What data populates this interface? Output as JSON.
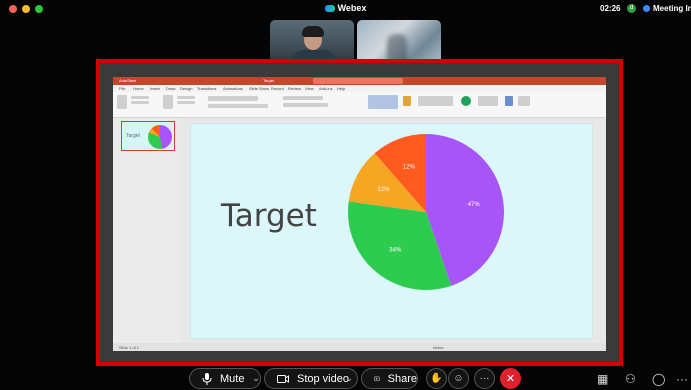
{
  "window": {
    "title": "Webex",
    "clock": "02:26",
    "avatar_initial": "d",
    "meeting_label": "Meeting In"
  },
  "shared_app": {
    "title": "Target",
    "search_placeholder": "Search (Cmd+E)",
    "tabs": [
      "File",
      "Home",
      "Insert",
      "Draw",
      "Design",
      "Transitions",
      "Animations",
      "Slide Show",
      "Record",
      "Review",
      "View",
      "Add-ins",
      "Help"
    ],
    "status_left": "Slide 1 of 1",
    "status_right": "Notes"
  },
  "slide": {
    "title": "Target",
    "thumb_title": "Target",
    "pie_colors": [
      "#a855f7",
      "#2ecc4e",
      "#f5a623",
      "#ff5a1f"
    ],
    "pie_labels": [
      "47%",
      "34%",
      "12%",
      "12%"
    ]
  },
  "chart_data": {
    "type": "pie",
    "values": [
      47,
      34,
      12,
      12
    ],
    "labels": [
      "47%",
      "34%",
      "12%",
      "12%"
    ],
    "colors": [
      "#a855f7",
      "#2ecc4e",
      "#f5a623",
      "#ff5a1f"
    ]
  },
  "controls": {
    "mute_label": "Mute",
    "video_label": "Stop video",
    "share_label": "Share",
    "icons": [
      "microphone-icon",
      "camera-icon",
      "share-screen-icon",
      "raise-hand-icon",
      "reactions-icon",
      "more-icon",
      "end-call-icon",
      "apps-icon",
      "participants-icon",
      "chat-icon",
      "overflow-icon"
    ]
  }
}
